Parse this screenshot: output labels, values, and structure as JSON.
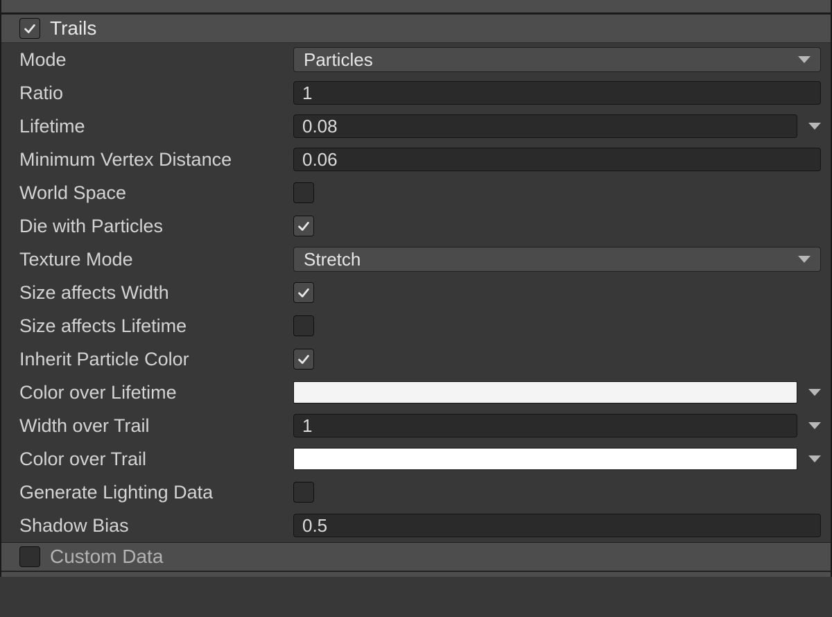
{
  "modules": {
    "trails": {
      "title": "Trails",
      "enabled": true
    },
    "customData": {
      "title": "Custom Data",
      "enabled": false
    }
  },
  "props": {
    "mode": {
      "label": "Mode",
      "value": "Particles"
    },
    "ratio": {
      "label": "Ratio",
      "value": "1"
    },
    "lifetime": {
      "label": "Lifetime",
      "value": "0.08"
    },
    "minVertexDistance": {
      "label": "Minimum Vertex Distance",
      "value": "0.06"
    },
    "worldSpace": {
      "label": "World Space",
      "value": false
    },
    "dieWithParticles": {
      "label": "Die with Particles",
      "value": true
    },
    "textureMode": {
      "label": "Texture Mode",
      "value": "Stretch"
    },
    "sizeAffectsWidth": {
      "label": "Size affects Width",
      "value": true
    },
    "sizeAffectsLifetime": {
      "label": "Size affects Lifetime",
      "value": false
    },
    "inheritParticleColor": {
      "label": "Inherit Particle Color",
      "value": true
    },
    "colorOverLifetime": {
      "label": "Color over Lifetime",
      "value": "#f4f4f4"
    },
    "widthOverTrail": {
      "label": "Width over Trail",
      "value": "1"
    },
    "colorOverTrail": {
      "label": "Color over Trail",
      "value": "#ffffff"
    },
    "generateLightingData": {
      "label": "Generate Lighting Data",
      "value": false
    },
    "shadowBias": {
      "label": "Shadow Bias",
      "value": "0.5"
    }
  }
}
